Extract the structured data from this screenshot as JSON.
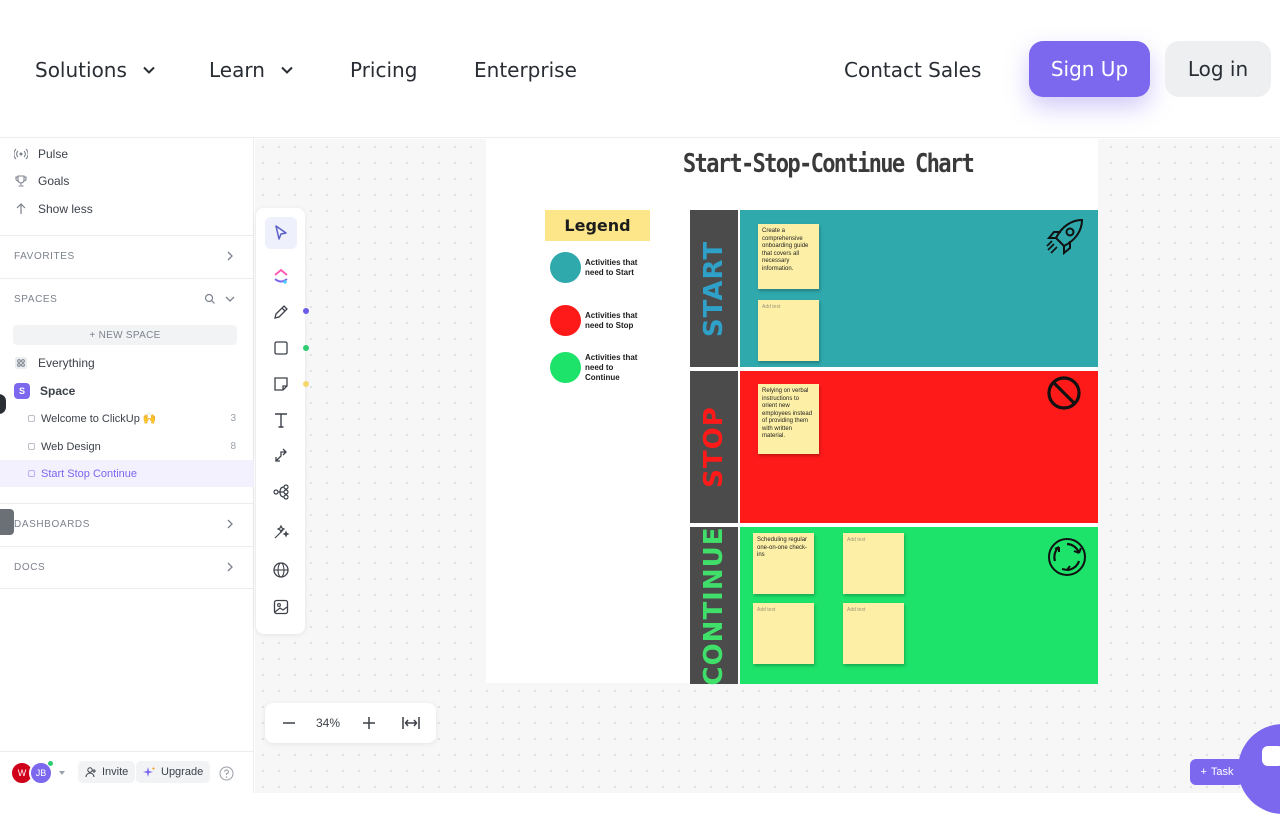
{
  "nav": {
    "solutions": "Solutions",
    "learn": "Learn",
    "pricing": "Pricing",
    "enterprise": "Enterprise",
    "contact_sales": "Contact Sales",
    "sign_up": "Sign Up",
    "log_in": "Log in"
  },
  "sidebar": {
    "pulse": "Pulse",
    "goals": "Goals",
    "show_less": "Show less",
    "favorites": "FAVORITES",
    "spaces": "SPACES",
    "new_space": "+ NEW SPACE",
    "everything": "Everything",
    "space_badge": "S",
    "space": "Space",
    "lists": [
      {
        "label": "Welcome to ClickUp 🙌",
        "count": "3"
      },
      {
        "label": "Web Design",
        "count": "8"
      },
      {
        "label": "Start Stop Continue",
        "count": ""
      }
    ],
    "dashboards": "DASHBOARDS",
    "docs": "DOCS",
    "avatar_1": "W",
    "avatar_2": "JB",
    "invite": "Invite",
    "upgrade": "Upgrade"
  },
  "canvas": {
    "zoom": "34%",
    "tool_dot_colors": [
      "#6b5ce7",
      "#2ecc71",
      "#f5d76e"
    ]
  },
  "board": {
    "title": "Start-Stop-Continue Chart",
    "legend": {
      "title": "Legend",
      "items": [
        {
          "label": "Activities that need to Start",
          "color": "#2fa9ac"
        },
        {
          "label": "Activities that need to Stop",
          "color": "#ff1a1a"
        },
        {
          "label": "Activities that need to Continue",
          "color": "#1de36b"
        }
      ]
    },
    "rows": [
      {
        "label": "START",
        "label_color": "#2fa0c8",
        "bg": "#2fa9ac",
        "icon": "rocket-icon"
      },
      {
        "label": "STOP",
        "label_color": "#ff1a1a",
        "bg": "#ff1a1a",
        "icon": "prohibited-icon"
      },
      {
        "label": "CONTINUE",
        "label_color": "#3fdf6a",
        "bg": "#1de36b",
        "icon": "cycle-icon"
      }
    ],
    "stickies": {
      "start_1": "Create a comprehensive onboarding guide that covers all necessary information.",
      "start_2": "Add text",
      "stop_1": "Relying on verbal instructions to orient new employees instead of providing them with written material.",
      "continue_1": "Scheduling regular one-on-one check-ins",
      "continue_2": "Add text",
      "continue_3": "Add text",
      "continue_4": "Add text"
    }
  },
  "task_button": "Task"
}
